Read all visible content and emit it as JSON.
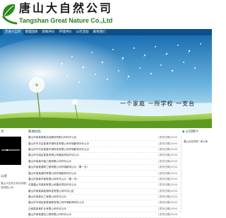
{
  "brand": {
    "cn_name": "唐山大自然公司",
    "en_name": "Tangshan Great Nature Co.,Ltd",
    "accent": "#2a8a1f",
    "nav_bg": "#0d4f8a"
  },
  "nav": {
    "items": [
      "走进大自然",
      "管理团体",
      "新闻评价",
      "环境评价",
      "公司活动",
      "联系我们"
    ]
  },
  "banner": {
    "slogan": "一个家庭 一所学校 一支台"
  },
  "sections": {
    "left_title": "文",
    "left_bottom_title": "公式",
    "left_bottom_text": "唐山大自然文体活动服务有限公司",
    "news_title": "新闻动态",
    "right_title": "公司简介",
    "right_text": "唐山大自然是一家从事"
  },
  "news": [
    {
      "title": "唐山市某某新闻活动服务有限公司环评公告",
      "date": "[发布日期]2016-"
    },
    {
      "title": "唐山市开平区某某环境科技有限公司环境影响评价公示",
      "date": "[发布日期]2016-"
    },
    {
      "title": "唐山市开平区某某环境科技有限公司环境影响评价公示",
      "date": "[发布日期]2016-"
    },
    {
      "title": "唐山市丰南区某某有限公司建设项目环评公示",
      "date": "[发布日期]2016-"
    },
    {
      "title": "唐山市某某环保工程有限公司环评公示",
      "date": "[发布日期]2016-"
    },
    {
      "title": "唐山市某某建筑工程有限公司环境影响公示（第一次）",
      "date": "[发布日期]2016-"
    },
    {
      "title": "唐山市某某建材有限公司环境影响评价公示",
      "date": "[发布日期]2016-"
    },
    {
      "title": "唐山市某某环保有限公司环评公示（第一次）",
      "date": "[发布日期]2016-"
    },
    {
      "title": "中国唐山市某某有限公司建设项目环评公示",
      "date": "[发布日期]2016-"
    },
    {
      "title": "唐山市某某新能源科技有限公司环评公告",
      "date": "[发布日期]2016-"
    },
    {
      "title": "唐山市某某化工有限公司环评公示",
      "date": "[发布日期]2016-"
    },
    {
      "title": "唐山市丰润区某某钢铁有限公司环境影响评价公示",
      "date": "[发布日期]2016-"
    },
    {
      "title": "迁西县某某矿业有限公司环评公示",
      "date": "[发布日期]2016-"
    },
    {
      "title": "唐山市某某建设工程有限公司环评公示",
      "date": "[发布日期]2016-"
    }
  ]
}
